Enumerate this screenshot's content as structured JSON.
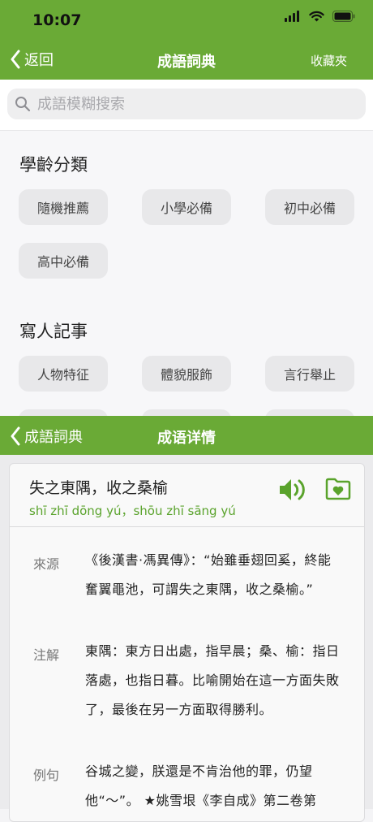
{
  "status": {
    "time": "10:07"
  },
  "top_nav": {
    "back_label": "返回",
    "title": "成語詞典",
    "right_label": "收藏夾"
  },
  "search": {
    "placeholder": "成語模糊搜索"
  },
  "sections": [
    {
      "title": "學齡分類",
      "tags": [
        "隨機推薦",
        "小學必備",
        "初中必備",
        "高中必備"
      ]
    },
    {
      "title": "寫人記事",
      "tags": [
        "人物特征",
        "體貌服飾",
        "言行舉止"
      ]
    }
  ],
  "detail_nav": {
    "back_label": "成語詞典",
    "title": "成语详情"
  },
  "idiom": {
    "title": "失之東隅，收之桑榆",
    "pinyin": "shī zhī dōng yú，shōu zhī sāng yú",
    "rows": [
      {
        "label": "來源",
        "text": "《後漢書·馮異傳》：“始雖垂翅回奚，終能奮翼黽池，可謂失之東隅，收之桑榆。”"
      },
      {
        "label": "注解",
        "text": "東隅：東方日出處，指早晨；桑、榆：指日落處，也指日暮。比喻開始在這一方面失敗了，最後在另一方面取得勝利。"
      },
      {
        "label": "例句",
        "text": "谷城之變，朕還是不肯治他的罪，仍望他“～”。 ★姚雪垠《李自成》第二卷第"
      }
    ]
  },
  "colors": {
    "accent": "#6aaa36",
    "pinyin": "#5aa32c"
  }
}
